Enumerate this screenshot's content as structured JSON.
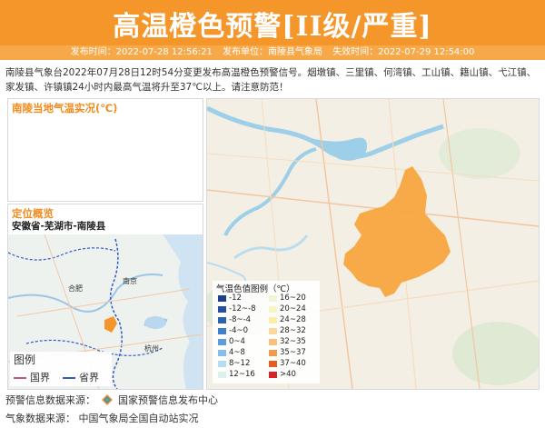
{
  "header": {
    "title": "高温橙色预警[II级/严重]",
    "publish_time": "发布时间：2022-07-28 12:56:21",
    "publisher": "发布单位：南陵县气象局",
    "expire_time": "失效时间：2022-07-29 12:54:00"
  },
  "description": "南陵县气象台2022年07月28日12时54分变更发布高温橙色预警信号。烟墩镇、三里镇、何湾镇、工山镇、籍山镇、弋江镇、家发镇、许镇镇24小时内最高气温将升至37℃以上。请注意防范！",
  "temp_panel": {
    "title": "南陵当地气温实况(℃)"
  },
  "location_panel": {
    "title": "定位概览",
    "location": "安徽省-芜湖市-南陵县",
    "map_labels": {
      "hefei": "合肥",
      "nanjing": "南京",
      "hangzhou": "杭州"
    },
    "legend_title": "图例",
    "legend_items": [
      {
        "label": "国界",
        "color": "#c8566f"
      },
      {
        "label": "省界",
        "color": "#3059c9"
      }
    ]
  },
  "main_map": {
    "legend_title": "气温色值图例（℃）",
    "legend_items": [
      {
        "label": "-12",
        "color": "#1e3f8c"
      },
      {
        "label": "16~20",
        "color": "#eef7d6"
      },
      {
        "label": "-12~-8",
        "color": "#23519e"
      },
      {
        "label": "20~24",
        "color": "#f7f7c6"
      },
      {
        "label": "-8~-4",
        "color": "#2d62b1"
      },
      {
        "label": "24~28",
        "color": "#fbeeaa"
      },
      {
        "label": "-4~0",
        "color": "#3f7fcb"
      },
      {
        "label": "28~32",
        "color": "#fbd99a"
      },
      {
        "label": "0~4",
        "color": "#5c9ddc"
      },
      {
        "label": "32~35",
        "color": "#f9c07c"
      },
      {
        "label": "4~8",
        "color": "#86bde9"
      },
      {
        "label": "35~37",
        "color": "#f39a4b"
      },
      {
        "label": "8~12",
        "color": "#b6dcf1"
      },
      {
        "label": "37~40",
        "color": "#e55d25"
      },
      {
        "label": "12~16",
        "color": "#dff1ed"
      },
      {
        "label": ">40",
        "color": "#d9232b"
      }
    ],
    "warning_area_color": "#f7a43c"
  },
  "footer": {
    "source1_label": "预警信息数据来源：",
    "source1_value": "国家预警信息发布中心",
    "source2_label": "气象数据来源：",
    "source2_value": "中国气象局全国自动站实况"
  }
}
